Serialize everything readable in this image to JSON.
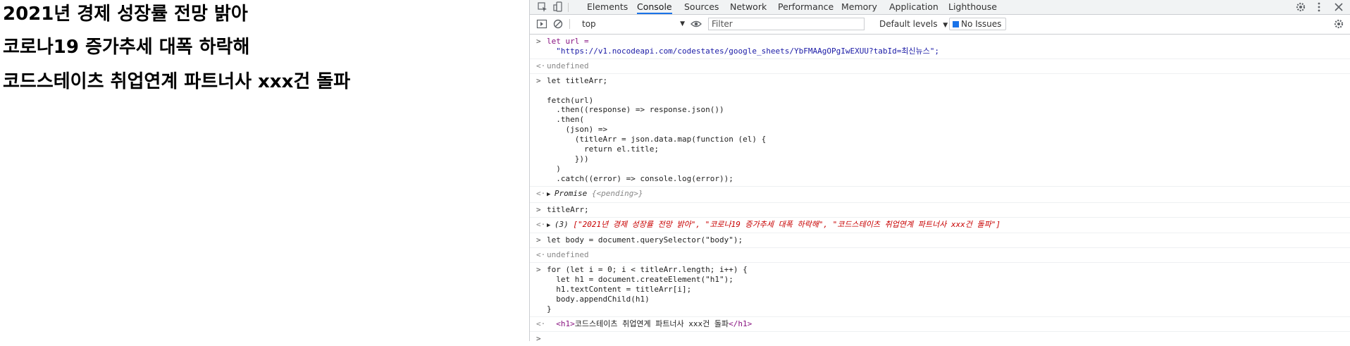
{
  "page": {
    "headings": [
      "2021년 경제 성장률 전망 밝아",
      "코로나19 증가추세 대폭 하락해",
      "코드스테이츠 취업연계 파트너사 xxx건 돌파"
    ]
  },
  "devtools": {
    "tabs": [
      "Elements",
      "Console",
      "Sources",
      "Network",
      "Performance",
      "Memory",
      "Application",
      "Lighthouse"
    ],
    "active_tab": "Console",
    "context": "top",
    "filter_placeholder": "Filter",
    "levels": "Default levels",
    "issues": "No Issues"
  },
  "console": {
    "l1a": "let url =",
    "l1b": "  \"https://v1.nocodeapi.com/codestates/google_sheets/YbFMAAgOPgIwEXUU?tabId=최신뉴스\";",
    "r1": "undefined",
    "c2": "let titleArr;\n\nfetch(url)\n  .then((response) => response.json())\n  .then(\n    (json) =>\n      (titleArr = json.data.map(function (el) {\n        return el.title;\n      }))\n  )\n  .catch((error) => console.log(error));",
    "r2a": "Promise ",
    "r2b": "{<pending>}",
    "c3": "titleArr;",
    "r3a": "(3) ",
    "r3b": "[\"2021년 경제 성장률 전망 밝아\", \"코로나19 증가추세 대폭 하락해\", \"코드스테이츠 취업연계 파트너사 xxx건 돌파\"]",
    "c4": "let body = document.querySelector(\"body\");",
    "r4": "undefined",
    "c5": "for (let i = 0; i < titleArr.length; i++) {\n  let h1 = document.createElement(\"h1\");\n  h1.textContent = titleArr[i];\n  body.appendChild(h1)\n}",
    "r5_open": "<h1>",
    "r5_text": "코드스테이츠 취업연계 파트너사 xxx건 돌파",
    "r5_close": "</h1>"
  }
}
